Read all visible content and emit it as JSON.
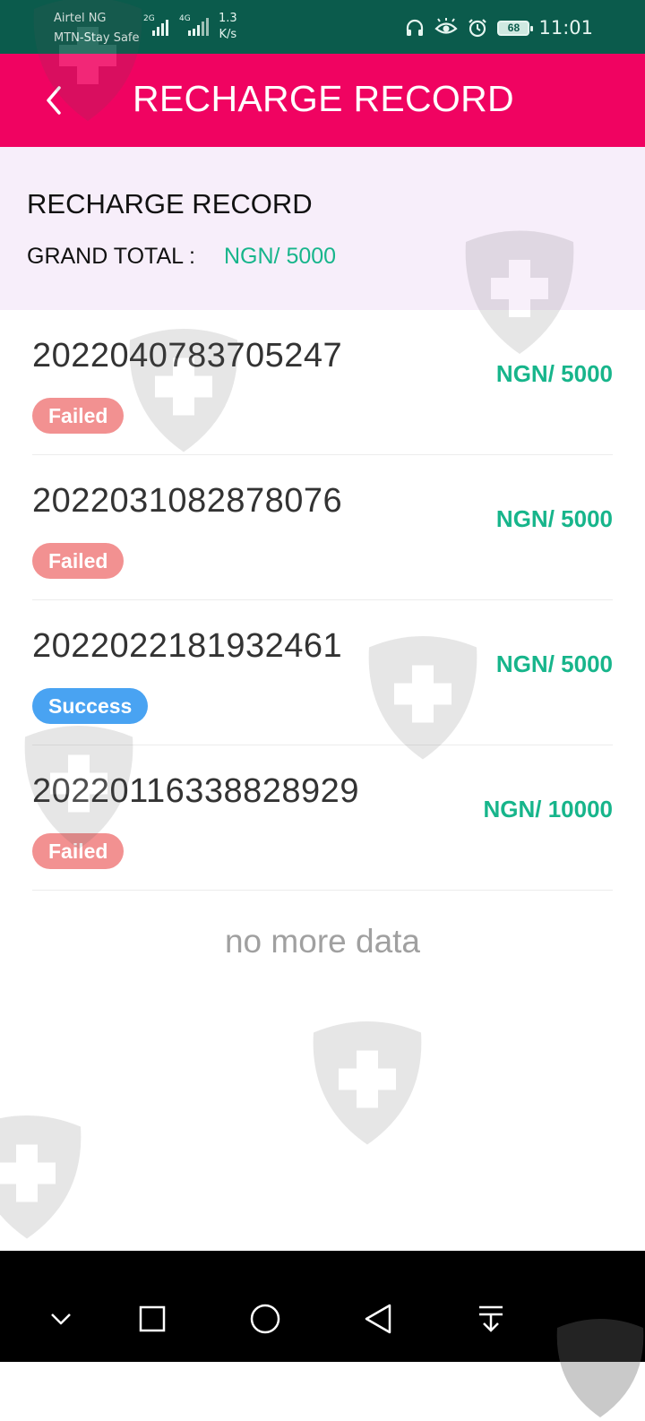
{
  "status_bar": {
    "carrier_1": "Airtel NG",
    "carrier_2": "MTN-Stay Safe",
    "net_type_1": "2G",
    "net_type_2": "4G",
    "speed_value": "1.3",
    "speed_unit": "K/s",
    "battery": "68",
    "time": "11:01",
    "icons": [
      "headphones-icon",
      "eye-icon",
      "alarm-icon",
      "battery-icon"
    ]
  },
  "header": {
    "title": "RECHARGE RECORD",
    "back_icon": "chevron-left-icon",
    "background": "#f00361"
  },
  "summary": {
    "title": "RECHARGE RECORD",
    "total_label": "GRAND TOTAL :",
    "total_value": "NGN/ 5000"
  },
  "records": [
    {
      "id": "2022040783705247",
      "amount": "NGN/ 5000",
      "status": "Failed"
    },
    {
      "id": "2022031082878076",
      "amount": "NGN/ 5000",
      "status": "Failed"
    },
    {
      "id": "2022022181932461",
      "amount": "NGN/ 5000",
      "status": "Success"
    },
    {
      "id": "2022011633882892‌9",
      "amount": "NGN/ 10000",
      "status": "Failed"
    }
  ],
  "footer_text": "no more data",
  "nav_bar": {
    "buttons": [
      "chevron-down-icon",
      "recent-apps-icon",
      "home-icon",
      "back-icon",
      "notification-pull-icon"
    ]
  },
  "colors": {
    "amount": "#17b58b",
    "failed_badge": "#f29191",
    "success_badge": "#49a3f2",
    "summary_bg": "#f7eefa",
    "status_bar_bg": "#0b5b4c"
  }
}
